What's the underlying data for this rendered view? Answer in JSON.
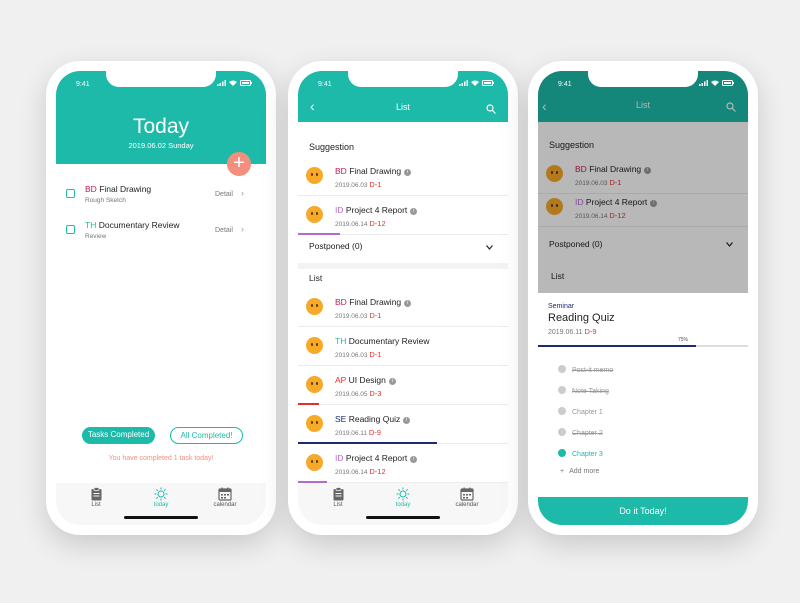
{
  "colors": {
    "teal": "#1dbaa9",
    "fab": "#f48f7e",
    "dday": "#e0322d",
    "navy": "#1e2a6b"
  },
  "status_time": "9:41",
  "nav": {
    "list": "List",
    "today": "today",
    "calendar": "calendar"
  },
  "today_screen": {
    "title": "Today",
    "date": "2019.06.02 Sunday",
    "fab_icon": "+",
    "tasks": [
      {
        "tag": "BD",
        "tag_color": "#c2185b",
        "title": "Final Drawing",
        "sub": "Rough Sketch",
        "action": "Detail"
      },
      {
        "tag": "TH",
        "tag_color": "#1dbaa9",
        "title": "Documentary Review",
        "sub": "Review",
        "action": "Detail"
      }
    ],
    "tasks_completed_label": "Tasks Completed",
    "all_completed_label": "All Completed!",
    "completed_message": "You have completed 1 task today!"
  },
  "list_screen": {
    "title": "List",
    "suggestion_label": "Suggestion",
    "postponed_label": "Postponed (0)",
    "list_label": "List",
    "suggestions": [
      {
        "tag": "BD",
        "tag_color": "#c2185b",
        "title": "Final Drawing",
        "date": "2019.06.03",
        "dday": "D-1",
        "underline": ""
      },
      {
        "tag": "ID",
        "tag_color": "#b46bc9",
        "title": "Project 4 Report",
        "date": "2019.06.14",
        "dday": "D-12",
        "underline": "#b46bc9",
        "underline_ratio": 0.2
      }
    ],
    "items": [
      {
        "tag": "BD",
        "tag_color": "#c2185b",
        "title": "Final Drawing",
        "date": "2019.06.03",
        "dday": "D-1",
        "info": true,
        "underline": ""
      },
      {
        "tag": "TH",
        "tag_color": "#1dbaa9",
        "title": "Documentary Review",
        "date": "2019.06.03",
        "dday": "D-1",
        "info": false,
        "underline": ""
      },
      {
        "tag": "AP",
        "tag_color": "#e0322d",
        "title": "UI Design",
        "date": "2019.06.05",
        "dday": "D-3",
        "info": true,
        "underline": "#e0322d",
        "underline_ratio": 0.1
      },
      {
        "tag": "SE",
        "tag_color": "#1e2a6b",
        "title": "Reading Quiz",
        "date": "2019.06.11",
        "dday": "D-9",
        "info": true,
        "underline": "#1e2a6b",
        "underline_ratio": 0.66
      },
      {
        "tag": "ID",
        "tag_color": "#b46bc9",
        "title": "Project 4 Report",
        "date": "2019.06.14",
        "dday": "D-12",
        "info": true,
        "underline": "#b46bc9",
        "underline_ratio": 0.14
      }
    ]
  },
  "detail_screen": {
    "title": "List",
    "suggestion_label": "Suggestion",
    "postponed_label": "Postponed (0)",
    "list_label": "List",
    "suggestions": [
      {
        "tag": "BD",
        "tag_color": "#c2185b",
        "title": "Final Drawing",
        "date": "2019.06.03",
        "dday": "D-1"
      },
      {
        "tag": "ID",
        "tag_color": "#b46bc9",
        "title": "Project 4 Report",
        "date": "2019.06.14",
        "dday": "D-12"
      }
    ],
    "category": "Seminar",
    "task_title": "Reading Quiz",
    "task_date": "2019.06.11",
    "task_dday": "D-9",
    "progress_label": "75%",
    "progress_value": 0.75,
    "steps": [
      {
        "label": "Post-it memo",
        "state": "done"
      },
      {
        "label": "Note Taking",
        "state": "done"
      },
      {
        "label": "Chapter 1",
        "state": "todo"
      },
      {
        "label": "Chapter 2",
        "state": "done"
      },
      {
        "label": "Chapter 3",
        "state": "current"
      }
    ],
    "add_more": "Add more",
    "cta": "Do it Today!"
  }
}
